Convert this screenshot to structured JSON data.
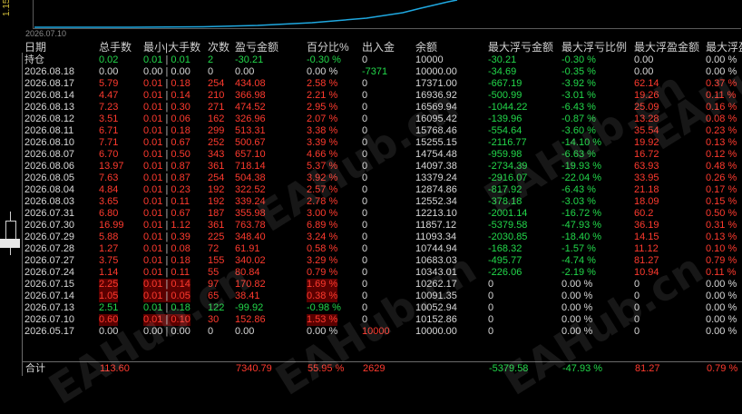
{
  "strip_label": "1.15",
  "chart": {
    "date_label": "2026.07.10"
  },
  "headers": [
    "日期",
    "总手数",
    "最小|大手数",
    "次数",
    "盈亏金额",
    "百分比%",
    "出入金",
    "余额",
    "最大浮亏金额",
    "最大浮亏比例",
    "最大浮盈金额",
    "最大浮盈"
  ],
  "holding": {
    "label": "持仓",
    "lots": "0.02",
    "minmax_a": "0.01",
    "minmax_b": "0.01",
    "count": "2",
    "pnl": "-30.21",
    "pct": "-0.30 %",
    "cash": "0",
    "balance": "10000",
    "max_dd": "-30.21",
    "max_dd_pct": "-0.30 %",
    "max_fp": "0.00",
    "max_fp_pct": "0.00 %"
  },
  "rows": [
    {
      "date": "2026.08.18",
      "lots": "0.00",
      "a": "0.00",
      "b": "0.00",
      "count": "0",
      "pnl": "0.00",
      "pct": "0.00 %",
      "cash": "-7371",
      "balance": "10000.00",
      "dd": "-34.69",
      "ddp": "-0.35 %",
      "fp": "0.00",
      "fpp": "0.00 %",
      "style": "plain"
    },
    {
      "date": "2026.08.17",
      "lots": "5.79",
      "a": "0.01",
      "b": "0.18",
      "count": "254",
      "pnl": "434.08",
      "pct": "2.58 %",
      "cash": "0",
      "balance": "17371.00",
      "dd": "-667.19",
      "ddp": "-3.92 %",
      "fp": "62.14",
      "fpp": "0.37 %",
      "style": "red"
    },
    {
      "date": "2026.08.14",
      "lots": "4.47",
      "a": "0.01",
      "b": "0.14",
      "count": "210",
      "pnl": "366.98",
      "pct": "2.21 %",
      "cash": "0",
      "balance": "16936.92",
      "dd": "-500.99",
      "ddp": "-3.01 %",
      "fp": "19.26",
      "fpp": "0.11 %",
      "style": "red"
    },
    {
      "date": "2026.08.13",
      "lots": "7.23",
      "a": "0.01",
      "b": "0.30",
      "count": "271",
      "pnl": "474.52",
      "pct": "2.95 %",
      "cash": "0",
      "balance": "16569.94",
      "dd": "-1044.22",
      "ddp": "-6.43 %",
      "fp": "25.09",
      "fpp": "0.16 %",
      "style": "red"
    },
    {
      "date": "2026.08.12",
      "lots": "3.51",
      "a": "0.01",
      "b": "0.06",
      "count": "162",
      "pnl": "326.96",
      "pct": "2.07 %",
      "cash": "0",
      "balance": "16095.42",
      "dd": "-139.96",
      "ddp": "-0.87 %",
      "fp": "13.28",
      "fpp": "0.08 %",
      "style": "red"
    },
    {
      "date": "2026.08.11",
      "lots": "6.71",
      "a": "0.01",
      "b": "0.18",
      "count": "299",
      "pnl": "513.31",
      "pct": "3.38 %",
      "cash": "0",
      "balance": "15768.46",
      "dd": "-554.64",
      "ddp": "-3.60 %",
      "fp": "35.54",
      "fpp": "0.23 %",
      "style": "red"
    },
    {
      "date": "2026.08.10",
      "lots": "7.71",
      "a": "0.01",
      "b": "0.67",
      "count": "252",
      "pnl": "500.67",
      "pct": "3.39 %",
      "cash": "0",
      "balance": "15255.15",
      "dd": "-2116.77",
      "ddp": "-14.10 %",
      "fp": "19.92",
      "fpp": "0.13 %",
      "style": "red"
    },
    {
      "date": "2026.08.07",
      "lots": "6.70",
      "a": "0.01",
      "b": "0.50",
      "count": "343",
      "pnl": "657.10",
      "pct": "4.66 %",
      "cash": "0",
      "balance": "14754.48",
      "dd": "-959.98",
      "ddp": "-6.63 %",
      "fp": "16.72",
      "fpp": "0.12 %",
      "style": "red"
    },
    {
      "date": "2026.08.06",
      "lots": "13.97",
      "a": "0.01",
      "b": "0.87",
      "count": "361",
      "pnl": "718.14",
      "pct": "5.37 %",
      "cash": "0",
      "balance": "14097.38",
      "dd": "-2734.39",
      "ddp": "-19.93 %",
      "fp": "63.93",
      "fpp": "0.48 %",
      "style": "red"
    },
    {
      "date": "2026.08.05",
      "lots": "7.63",
      "a": "0.01",
      "b": "0.87",
      "count": "254",
      "pnl": "504.38",
      "pct": "3.92 %",
      "cash": "0",
      "balance": "13379.24",
      "dd": "-2916.07",
      "ddp": "-22.04 %",
      "fp": "33.95",
      "fpp": "0.26 %",
      "style": "red"
    },
    {
      "date": "2026.08.04",
      "lots": "4.84",
      "a": "0.01",
      "b": "0.23",
      "count": "192",
      "pnl": "322.52",
      "pct": "2.57 %",
      "cash": "0",
      "balance": "12874.86",
      "dd": "-817.92",
      "ddp": "-6.43 %",
      "fp": "21.18",
      "fpp": "0.17 %",
      "style": "red"
    },
    {
      "date": "2026.08.03",
      "lots": "3.65",
      "a": "0.01",
      "b": "0.11",
      "count": "192",
      "pnl": "339.24",
      "pct": "2.78 %",
      "cash": "0",
      "balance": "12552.34",
      "dd": "-378.18",
      "ddp": "-3.03 %",
      "fp": "18.09",
      "fpp": "0.15 %",
      "style": "red"
    },
    {
      "date": "2026.07.31",
      "lots": "6.80",
      "a": "0.01",
      "b": "0.67",
      "count": "187",
      "pnl": "355.98",
      "pct": "3.00 %",
      "cash": "0",
      "balance": "12213.10",
      "dd": "-2001.14",
      "ddp": "-16.72 %",
      "fp": "60.2",
      "fpp": "0.50 %",
      "style": "red"
    },
    {
      "date": "2026.07.30",
      "lots": "16.99",
      "a": "0.01",
      "b": "1.12",
      "count": "361",
      "pnl": "763.78",
      "pct": "6.89 %",
      "cash": "0",
      "balance": "11857.12",
      "dd": "-5379.58",
      "ddp": "-47.93 %",
      "fp": "36.19",
      "fpp": "0.31 %",
      "style": "red"
    },
    {
      "date": "2026.07.29",
      "lots": "5.88",
      "a": "0.01",
      "b": "0.39",
      "count": "225",
      "pnl": "348.40",
      "pct": "3.24 %",
      "cash": "0",
      "balance": "11093.34",
      "dd": "-2030.85",
      "ddp": "-18.40 %",
      "fp": "14.15",
      "fpp": "0.13 %",
      "style": "red"
    },
    {
      "date": "2026.07.28",
      "lots": "1.27",
      "a": "0.01",
      "b": "0.08",
      "count": "72",
      "pnl": "61.91",
      "pct": "0.58 %",
      "cash": "0",
      "balance": "10744.94",
      "dd": "-168.32",
      "ddp": "-1.57 %",
      "fp": "11.12",
      "fpp": "0.10 %",
      "style": "red"
    },
    {
      "date": "2026.07.27",
      "lots": "3.75",
      "a": "0.01",
      "b": "0.18",
      "count": "155",
      "pnl": "340.02",
      "pct": "3.29 %",
      "cash": "0",
      "balance": "10683.03",
      "dd": "-495.77",
      "ddp": "-4.74 %",
      "fp": "81.27",
      "fpp": "0.79 %",
      "style": "red"
    },
    {
      "date": "2026.07.24",
      "lots": "1.14",
      "a": "0.01",
      "b": "0.11",
      "count": "55",
      "pnl": "80.84",
      "pct": "0.79 %",
      "cash": "0",
      "balance": "10343.01",
      "dd": "-226.06",
      "ddp": "-2.19 %",
      "fp": "10.94",
      "fpp": "0.11 %",
      "style": "red"
    },
    {
      "date": "2026.07.15",
      "lots": "2.25",
      "a": "0.01",
      "b": "0.14",
      "count": "97",
      "pnl": "170.82",
      "pct": "1.69 %",
      "cash": "0",
      "balance": "10262.17",
      "dd": "0",
      "ddp": "0.00 %",
      "fp": "0",
      "fpp": "0.00 %",
      "style": "redhl"
    },
    {
      "date": "2026.07.14",
      "lots": "1.05",
      "a": "0.01",
      "b": "0.05",
      "count": "65",
      "pnl": "38.41",
      "pct": "0.38 %",
      "cash": "0",
      "balance": "10091.35",
      "dd": "0",
      "ddp": "0.00 %",
      "fp": "0",
      "fpp": "0.00 %",
      "style": "redhl"
    },
    {
      "date": "2026.07.13",
      "lots": "2.51",
      "a": "0.01",
      "b": "0.18",
      "count": "122",
      "pnl": "-99.92",
      "pct": "-0.98 %",
      "cash": "0",
      "balance": "10052.94",
      "dd": "0",
      "ddp": "0.00 %",
      "fp": "0",
      "fpp": "0.00 %",
      "style": "green"
    },
    {
      "date": "2026.07.10",
      "lots": "0.60",
      "a": "0.01",
      "b": "0.10",
      "count": "30",
      "pnl": "152.86",
      "pct": "1.53 %",
      "cash": "0",
      "balance": "10152.86",
      "dd": "0",
      "ddp": "0.00 %",
      "fp": "0",
      "fpp": "0.00 %",
      "style": "redhl"
    },
    {
      "date": "2026.05.17",
      "lots": "0.00",
      "a": "0.00",
      "b": "0.00",
      "count": "0",
      "pnl": "0.00",
      "pct": "0.00 %",
      "cash": "10000",
      "balance": "10000.00",
      "dd": "0",
      "ddp": "0.00 %",
      "fp": "0",
      "fpp": "0.00 %",
      "style": "plain"
    }
  ],
  "total": {
    "label": "合计",
    "lots": "113.60",
    "pnl": "7340.79",
    "pct": "55.95 %",
    "cash": "2629",
    "dd": "-5379.58",
    "ddp": "-47.93 %",
    "fp": "81.27",
    "fpp": "0.79 %"
  },
  "watermark": "EAHub.cn",
  "colors": {
    "profit": "#ff3a2e",
    "loss": "#22d84a",
    "equity_line": "#1fa8e0"
  }
}
